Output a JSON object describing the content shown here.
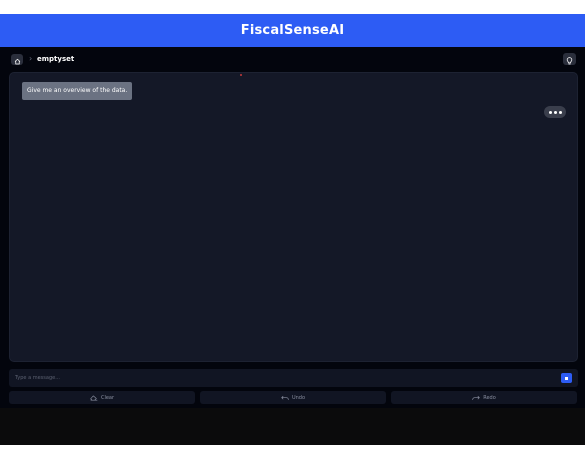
{
  "header": {
    "title": "FiscalSenseAI"
  },
  "breadcrumb": {
    "separator": "›",
    "current": "emptyset"
  },
  "chat": {
    "messages": [
      {
        "role": "user",
        "text": "Give me an overview of the data."
      }
    ]
  },
  "composer": {
    "placeholder": "Type a message..."
  },
  "actions": {
    "clear": "Clear",
    "undo": "Undo",
    "redo": "Redo"
  },
  "icons": {
    "home": "home-icon",
    "bulb": "lightbulb-icon",
    "more": "more-horizontal-icon",
    "send": "stop-square-icon",
    "clear": "eraser-icon",
    "undo": "undo-arrow-icon",
    "redo": "redo-arrow-icon"
  },
  "colors": {
    "accent": "#2d5cf4",
    "background": "#03050d",
    "panel": "#141827",
    "user_bubble": "#6b7282"
  }
}
